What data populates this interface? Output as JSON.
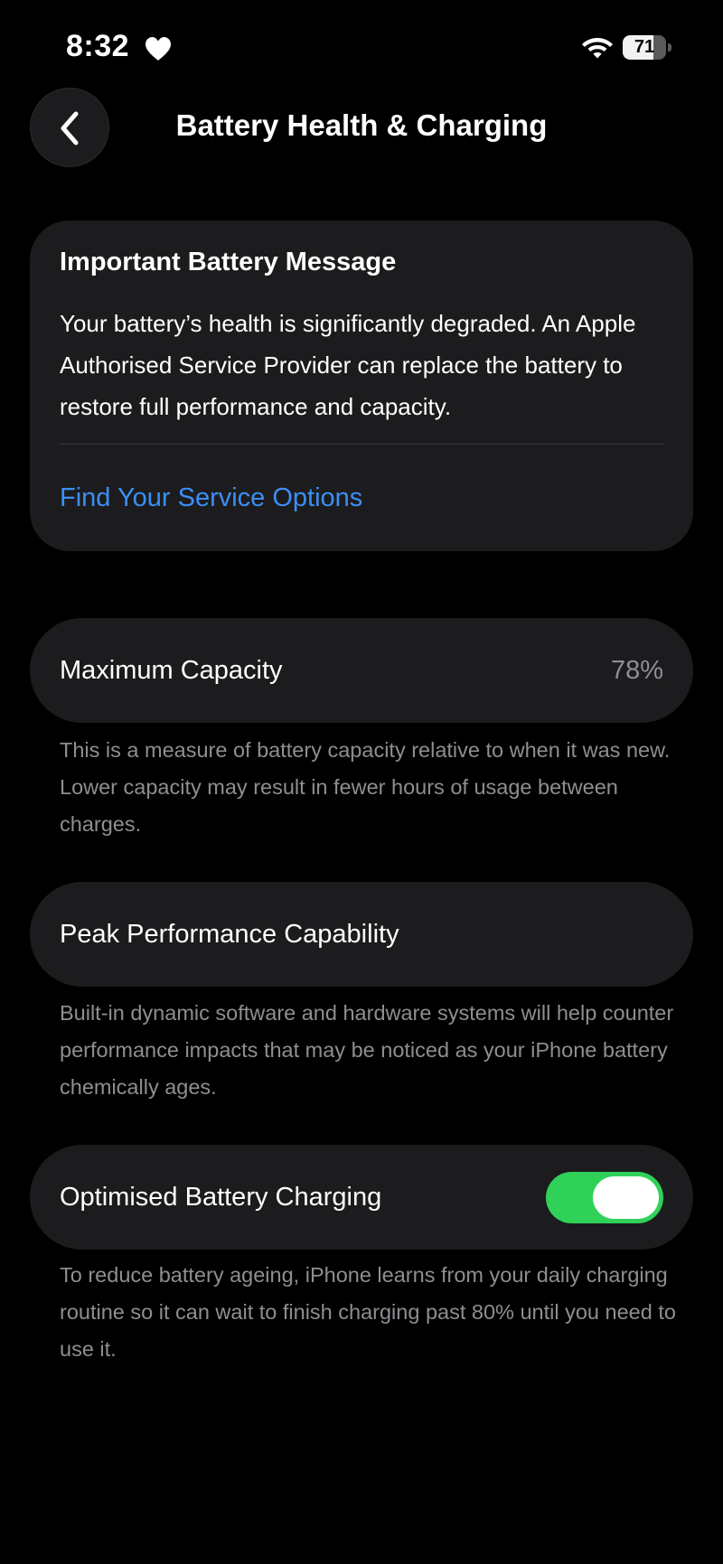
{
  "status_bar": {
    "time": "8:32",
    "heart_icon": "heart-icon",
    "wifi_icon": "wifi-icon",
    "battery_level": "71",
    "battery_fraction": 0.71
  },
  "nav": {
    "back_icon": "chevron-left-icon",
    "title": "Battery Health & Charging"
  },
  "message": {
    "title": "Important Battery Message",
    "body": "Your battery’s health is significantly degraded. An Apple Authorised Service Provider can replace the battery to restore full performance and capacity.",
    "link": "Find Your Service Options"
  },
  "max_capacity": {
    "label": "Maximum Capacity",
    "value": "78%",
    "footnote": "This is a measure of battery capacity relative to when it was new. Lower capacity may result in fewer hours of usage between charges."
  },
  "peak_performance": {
    "label": "Peak Performance Capability",
    "footnote": "Built-in dynamic software and hardware systems will help counter performance impacts that may be noticed as your iPhone battery chemically ages."
  },
  "optimised_charging": {
    "label": "Optimised Battery Charging",
    "enabled": true,
    "footnote": "To reduce battery ageing, iPhone learns from your daily charging routine so it can wait to finish charging past 80% until you need to use it."
  },
  "colors": {
    "background": "#000000",
    "card": "#1c1c1e",
    "link": "#3b8ff5",
    "secondary_text": "#8e8e93",
    "toggle_on": "#30d158"
  }
}
